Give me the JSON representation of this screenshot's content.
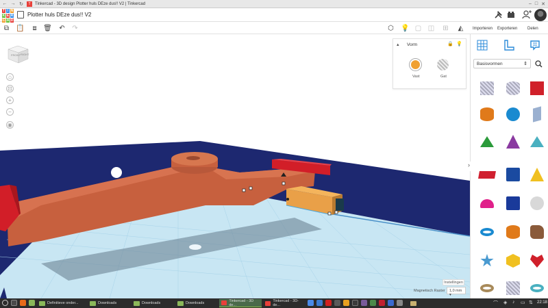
{
  "browser": {
    "tab_title": "Tinkercad - 3D design Plotter huls DEze dus!! V2 | Tinkercad"
  },
  "app": {
    "logo_letters": [
      "T",
      "I",
      "N",
      "K",
      "E",
      "R",
      "C",
      "A",
      "D"
    ],
    "logo_colors": [
      "#e8403a",
      "#3a8ee6",
      "#f0a030",
      "#67c23a",
      "#e8403a",
      "#3a8ee6",
      "#f0a030",
      "#67c23a",
      "#e8403a"
    ],
    "design_title": "Plotter huls DEze dus!! V2",
    "actions": {
      "import": "Importeren",
      "export": "Exporteren",
      "share": "Delen"
    }
  },
  "viewcube": {
    "top": "TOP",
    "front": "FRONT",
    "right": "RIGHT"
  },
  "shape_panel": {
    "title": "Vorm",
    "solid_label": "Vast",
    "hole_label": "Gat"
  },
  "settings": {
    "instellingen": "Instellingen",
    "snap_label": "Magnetisch Raster",
    "snap_value": "1,0 mm"
  },
  "library": {
    "category": "Basisvormen",
    "shapes": [
      {
        "name": "box-hole",
        "color": "#b9bcc2"
      },
      {
        "name": "cylinder-hole",
        "color": "#b9bcc2"
      },
      {
        "name": "box",
        "color": "#d0202a"
      },
      {
        "name": "cylinder",
        "color": "#e07a1a"
      },
      {
        "name": "sphere",
        "color": "#1a8ad0"
      },
      {
        "name": "scribble",
        "color": "#9ab0d0"
      },
      {
        "name": "roof",
        "color": "#2a9a3a"
      },
      {
        "name": "cone",
        "color": "#8a3aa0"
      },
      {
        "name": "round-roof",
        "color": "#4ab0c0"
      },
      {
        "name": "text",
        "color": "#d02030"
      },
      {
        "name": "polygon",
        "color": "#1a4aa0"
      },
      {
        "name": "pyramid",
        "color": "#f0c020"
      },
      {
        "name": "half-sphere",
        "color": "#e0208a"
      },
      {
        "name": "polygon-prism",
        "color": "#1a3a9a"
      },
      {
        "name": "paraboloid",
        "color": "#d8d8d8"
      },
      {
        "name": "torus",
        "color": "#1a8ad0"
      },
      {
        "name": "tube",
        "color": "#e07a1a"
      },
      {
        "name": "shape-generator",
        "color": "#8a5a3a"
      },
      {
        "name": "star",
        "color": "#4a9ad0"
      },
      {
        "name": "icosahedron",
        "color": "#f0c020"
      },
      {
        "name": "heart",
        "color": "#d0202a"
      },
      {
        "name": "ring",
        "color": "#a88a5a"
      },
      {
        "name": "hex-hole",
        "color": "#c0c0c0"
      },
      {
        "name": "half-torus",
        "color": "#4ab0c0"
      }
    ]
  },
  "taskbar": {
    "tasks": [
      "Definitieve onder...",
      "Downloads",
      "Downloads",
      "Downloads",
      "Tinkercad - 3D de...",
      "Tinkercad - 3D-de..."
    ],
    "clock": "22:18"
  }
}
